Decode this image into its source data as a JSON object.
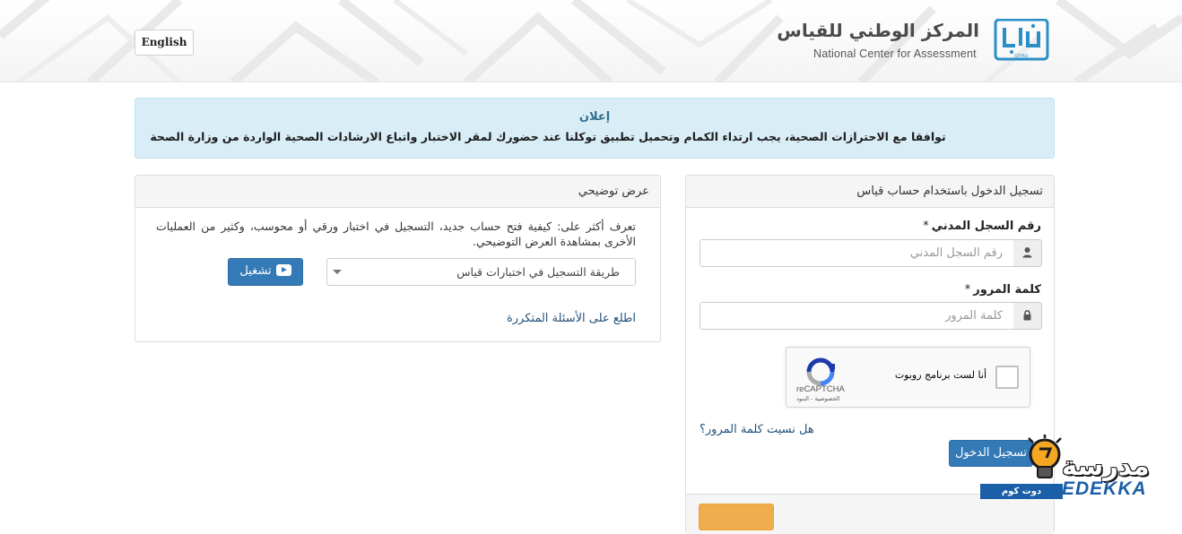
{
  "header": {
    "language_button": "English",
    "logo": {
      "arabic_name": "المركز الوطني للقياس",
      "english_name": "National Center for Assessment",
      "mark_caption": "QIYAS",
      "brand_color": "#2a8fc7"
    }
  },
  "announcement": {
    "title": "إعلان",
    "body": "توافقا مع الاحترازات الصحية، يجب ارتداء الكمام وتحميل تطبيق توكلنا عند حضورك لمقر الاختبار واتباع الارشادات الصحية الواردة من وزارة الصحة"
  },
  "demo_panel": {
    "heading": "عرض توضيحي",
    "description": "تعرف أكثر على: كيفية فتح حساب جديد، التسجيل في اختبار ورقي أو محوسب، وكثير من العمليات الأخرى بمشاهدة العرض التوضيحي.",
    "select_value": "طريقة التسجيل في اختبارات قياس",
    "play_button": "تشغيل",
    "faq_link": "اطلع على الأسئلة المتكررة"
  },
  "login_panel": {
    "heading": "تسجيل الدخول باستخدام حساب قياس",
    "id_label": "رقم السجل المدني",
    "id_placeholder": "رقم السجل المدني",
    "password_label": "كلمة المرور",
    "password_placeholder": "كلمة المرور",
    "required_mark": "*",
    "recaptcha": {
      "label": "أنا لست برنامج روبوت",
      "brand": "reCAPTCHA",
      "terms": "الخصوصية - البنود"
    },
    "forgot_link": "هل نسيت كلمة المرور؟",
    "login_button": "تسجيل الدخول"
  },
  "watermark": {
    "arabic": "مدرسة",
    "english": "EDEKKA",
    "domain": "دوت كوم"
  },
  "colors": {
    "primary": "#337ab7",
    "info_bg": "#d9edf7",
    "info_title": "#31708f",
    "link": "#23527c",
    "warning": "#f0ad4e"
  }
}
